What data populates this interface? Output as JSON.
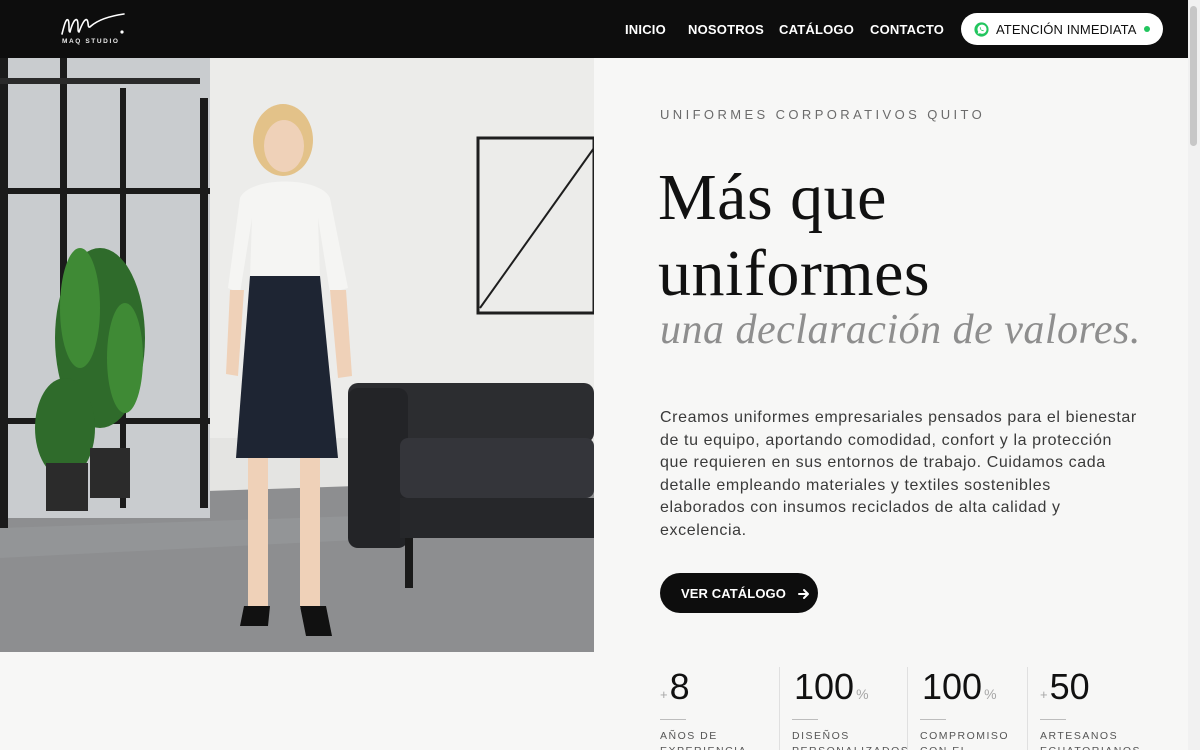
{
  "brand": {
    "name": "MAQ STUDIO"
  },
  "nav": {
    "items": [
      {
        "label": "INICIO"
      },
      {
        "label": "NOSOTROS"
      },
      {
        "label": "CATÁLOGO"
      },
      {
        "label": "CONTACTO"
      }
    ],
    "cta": {
      "label": "ATENCIÓN INMEDIATA",
      "icon": "whatsapp-icon",
      "status_color": "#22c55e"
    }
  },
  "hero": {
    "eyebrow": "UNIFORMES CORPORATIVOS QUITO",
    "headline_line1": "Más que",
    "headline_line2": "uniformes",
    "subheadline": "una declaración de valores.",
    "description": "Creamos uniformes empresariales pensados para el bienestar de tu equipo, aportando comodidad, confort y la protección que requieren en sus entornos de trabajo. Cuidamos cada detalle empleando materiales y textiles sostenibles elaborados con insumos reciclados de alta calidad y excelencia.",
    "cta_label": "VER CATÁLOGO",
    "cta_icon": "arrow-right-icon"
  },
  "stats": [
    {
      "prefix": "+",
      "value": "8",
      "suffix": "",
      "label": "AÑOS DE EXPERIENCIA"
    },
    {
      "prefix": "",
      "value": "100",
      "suffix": "%",
      "label": "DISEÑOS PERSONALIZADOS"
    },
    {
      "prefix": "",
      "value": "100",
      "suffix": "%",
      "label": "COMPROMISO CON EL"
    },
    {
      "prefix": "+",
      "value": "50",
      "suffix": "",
      "label": "ARTESANOS ECUATORIANOS"
    }
  ],
  "colors": {
    "nav_bg": "#0d0d0d",
    "page_bg": "#f7f7f6",
    "accent_dark": "#0d0d0d",
    "status_green": "#22c55e"
  }
}
